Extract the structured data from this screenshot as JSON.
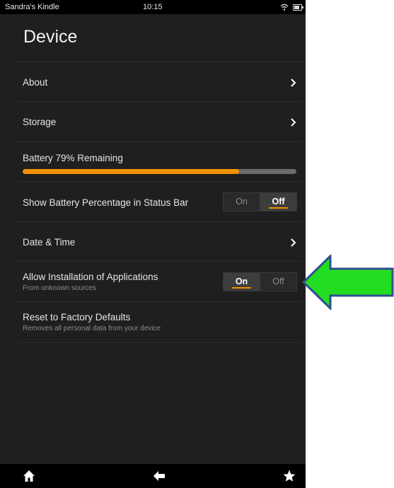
{
  "status_bar": {
    "owner": "Sandra's Kindle",
    "time": "10:15",
    "icons": [
      "wifi-icon",
      "battery-icon"
    ]
  },
  "page": {
    "title": "Device"
  },
  "settings": {
    "about": {
      "label": "About"
    },
    "storage": {
      "label": "Storage"
    },
    "battery": {
      "label": "Battery 79% Remaining",
      "level_percent": 79
    },
    "show_battery_pct": {
      "label": "Show Battery Percentage in Status Bar",
      "on": "On",
      "off": "Off",
      "selected": "Off"
    },
    "date_time": {
      "label": "Date & Time"
    },
    "allow_install": {
      "label": "Allow Installation of Applications",
      "sub": "From unknown sources",
      "on": "On",
      "off": "Off",
      "selected": "On"
    },
    "reset": {
      "label": "Reset to Factory Defaults",
      "sub": "Removes all personal data from your device"
    }
  },
  "navbar": {
    "icons": [
      "home-icon",
      "back-arrow-icon",
      "favorites-star-icon"
    ]
  },
  "colors": {
    "accent": "#f29100",
    "callout_arrow": "#22dd22",
    "callout_border": "#2f4f8f"
  }
}
